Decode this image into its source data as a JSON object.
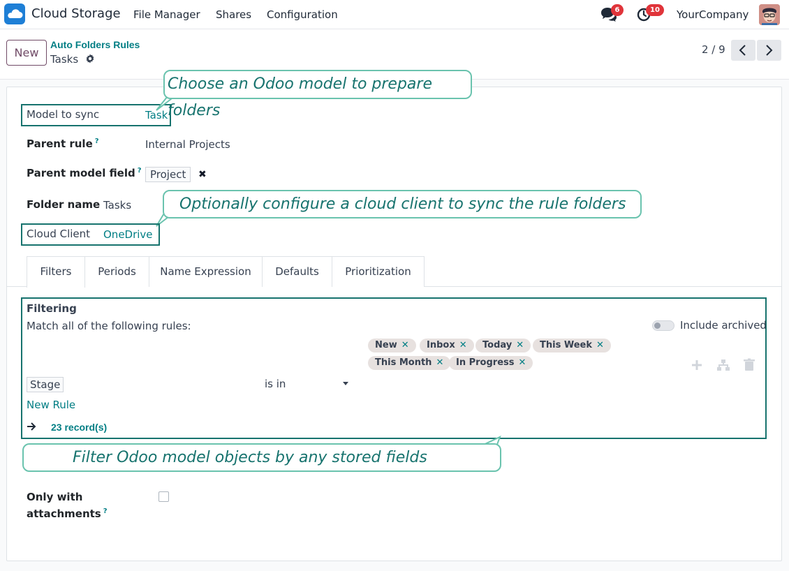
{
  "navbar": {
    "app_name": "Cloud Storage",
    "menus": [
      "File Manager",
      "Shares",
      "Configuration"
    ],
    "messages_count": "6",
    "activities_count": "10",
    "company": "YourCompany"
  },
  "control_panel": {
    "new_button": "New",
    "breadcrumb_parent": "Auto Folders Rules",
    "breadcrumb_current": "Tasks",
    "pager": "2 / 9"
  },
  "form": {
    "model_to_sync": {
      "label": "Model to sync",
      "value": "Task"
    },
    "parent_rule": {
      "label": "Parent rule",
      "help": "?",
      "value": "Internal Projects"
    },
    "parent_model_field": {
      "label": "Parent model field",
      "help": "?",
      "value": "Project"
    },
    "folder_name": {
      "label": "Folder name",
      "value": "Tasks"
    },
    "cloud_client": {
      "label": "Cloud Client",
      "value": "OneDrive"
    },
    "only_with_attachments": {
      "label_line1": "Only with",
      "label_line2": "attachments",
      "help": "?",
      "checked": false
    }
  },
  "callouts": {
    "model": "Choose an Odoo model to prepare folders",
    "cloud": "Optionally configure a cloud client to sync the rule folders",
    "filter": "Filter Odoo model objects by any stored fields"
  },
  "tabs": [
    "Filters",
    "Periods",
    "Name Expression",
    "Defaults",
    "Prioritization"
  ],
  "active_tab": "Filters",
  "filters": {
    "title": "Filtering",
    "description": "Match all of the following rules:",
    "include_archived": "Include archived",
    "include_archived_on": false,
    "rule_field": "Stage",
    "rule_operator": "is in",
    "values": [
      "New",
      "Inbox",
      "Today",
      "This Week",
      "This Month",
      "In Progress"
    ],
    "new_rule": "New Rule",
    "records": "23 record(s)"
  },
  "colors": {
    "accent_teal": "#017e84",
    "brand_purple": "#714b67",
    "highlight_border": "#17736e",
    "callout_border": "#6ac3ae",
    "badge_red": "#e0343a"
  }
}
